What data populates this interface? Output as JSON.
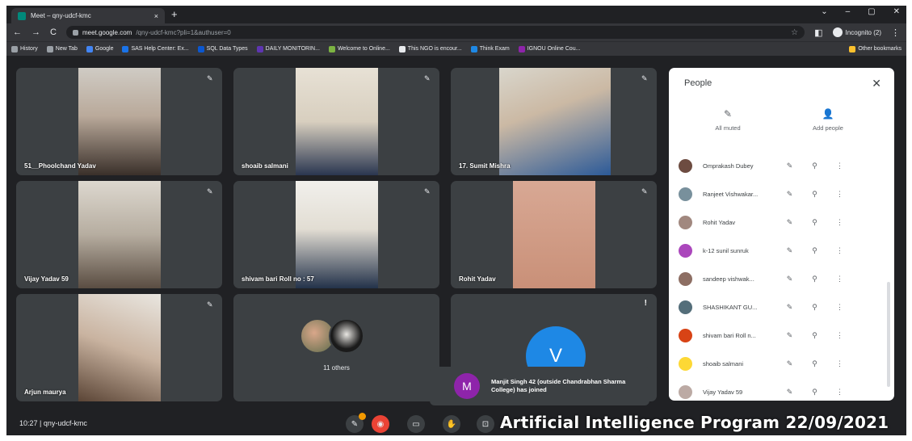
{
  "browser": {
    "tab_title": "Meet – qny-udcf-kmc",
    "tab_close": "×",
    "new_tab": "+",
    "win_controls": [
      "⌄",
      "–",
      "▢",
      "✕"
    ],
    "url_host": "meet.google.com",
    "url_path": "/qny-udcf-kmc?pli=1&authuser=0",
    "incognito_label": "Incognito (2)",
    "bookmarks": [
      {
        "label": "History",
        "color": "#9aa0a6"
      },
      {
        "label": "New Tab",
        "color": "#9aa0a6"
      },
      {
        "label": "Google",
        "color": "#4285f4"
      },
      {
        "label": "SAS Help Center: Ex...",
        "color": "#1a73e8"
      },
      {
        "label": "SQL Data Types",
        "color": "#0b57d0"
      },
      {
        "label": "DAILY MONITORIN...",
        "color": "#5e35b1"
      },
      {
        "label": "Welcome to Online...",
        "color": "#7cb342"
      },
      {
        "label": "This NGO is encour...",
        "color": "#e8eaed"
      },
      {
        "label": "Think Exam",
        "color": "#1e88e5"
      },
      {
        "label": "IGNOU Online Cou...",
        "color": "#8e24aa"
      }
    ],
    "other_bookmarks": "Other bookmarks"
  },
  "tiles": [
    {
      "name": "51__Phoolchand Yadav"
    },
    {
      "name": "shoaib salmani"
    },
    {
      "name": "17. Sumit Mishra"
    },
    {
      "name": "Vijay Yadav 59"
    },
    {
      "name": "shivam bari Roll no : 57"
    },
    {
      "name": "Rohit Yadav"
    },
    {
      "name": "Arjun maurya"
    },
    {
      "name": "11 others"
    },
    {
      "name": "V"
    }
  ],
  "people_panel": {
    "title": "People",
    "all_muted": "All muted",
    "add_people": "Add people",
    "participants": [
      {
        "name": "Omprakash Dubey",
        "color": "#6d4c41"
      },
      {
        "name": "Ranjeet Vishwakar...",
        "color": "#78909c"
      },
      {
        "name": "Rohit Yadav",
        "color": "#a1887f"
      },
      {
        "name": "k-12 sunil sunruk",
        "color": "#ab47bc"
      },
      {
        "name": "sandeep vishwak...",
        "color": "#8d6e63"
      },
      {
        "name": "SHASHIKANT GU...",
        "color": "#546e7a"
      },
      {
        "name": "shivam bari Roll n...",
        "color": "#d84315"
      },
      {
        "name": "shoaib salmani",
        "color": "#fdd835"
      },
      {
        "name": "Vijay Yadav 59",
        "color": "#bcaaa4"
      }
    ]
  },
  "toast": {
    "initial": "M",
    "text": "Manjit Singh 42 (outside Chandrabhan Sharma College) has joined"
  },
  "meeting": {
    "time": "10:27",
    "separator": "|",
    "code": "qny-udcf-kmc"
  },
  "watermark": "Artificial Intelligence Program 22/09/2021"
}
